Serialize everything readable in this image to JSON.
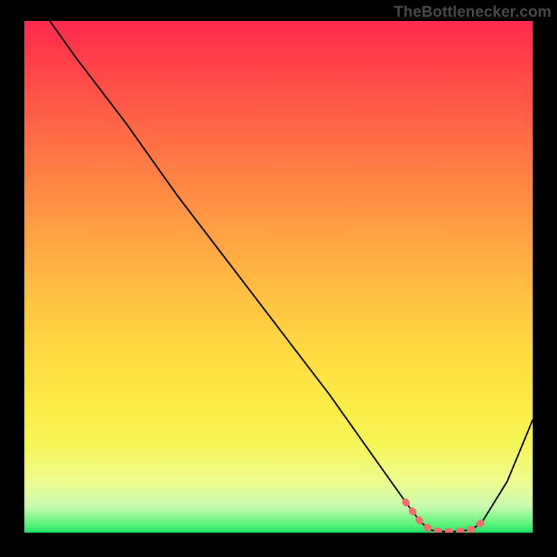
{
  "watermark": "TheBottlenecker.com",
  "chart_data": {
    "type": "line",
    "title": "",
    "xlabel": "",
    "ylabel": "",
    "xlim": [
      0,
      100
    ],
    "ylim": [
      0,
      100
    ],
    "annotations": [],
    "series": [
      {
        "name": "bottleneck-curve",
        "x": [
          5,
          10,
          20,
          30,
          40,
          50,
          60,
          70,
          75,
          78,
          80,
          82,
          85,
          88,
          90,
          95,
          100
        ],
        "values": [
          100,
          93,
          80,
          66,
          53,
          40,
          27,
          13,
          6,
          2,
          0.5,
          0.2,
          0.2,
          0.6,
          2,
          10,
          22
        ]
      },
      {
        "name": "optimal-band",
        "x": [
          75,
          78,
          80,
          82,
          85,
          88,
          90
        ],
        "values": [
          6,
          2,
          0.5,
          0.2,
          0.2,
          0.6,
          2
        ]
      }
    ],
    "gradient_stops": [
      {
        "pos": 0.0,
        "color": "#ff2a4e"
      },
      {
        "pos": 0.5,
        "color": "#ffb943"
      },
      {
        "pos": 0.8,
        "color": "#fcf048"
      },
      {
        "pos": 0.95,
        "color": "#c6fbb0"
      },
      {
        "pos": 1.0,
        "color": "#19e36a"
      }
    ]
  }
}
